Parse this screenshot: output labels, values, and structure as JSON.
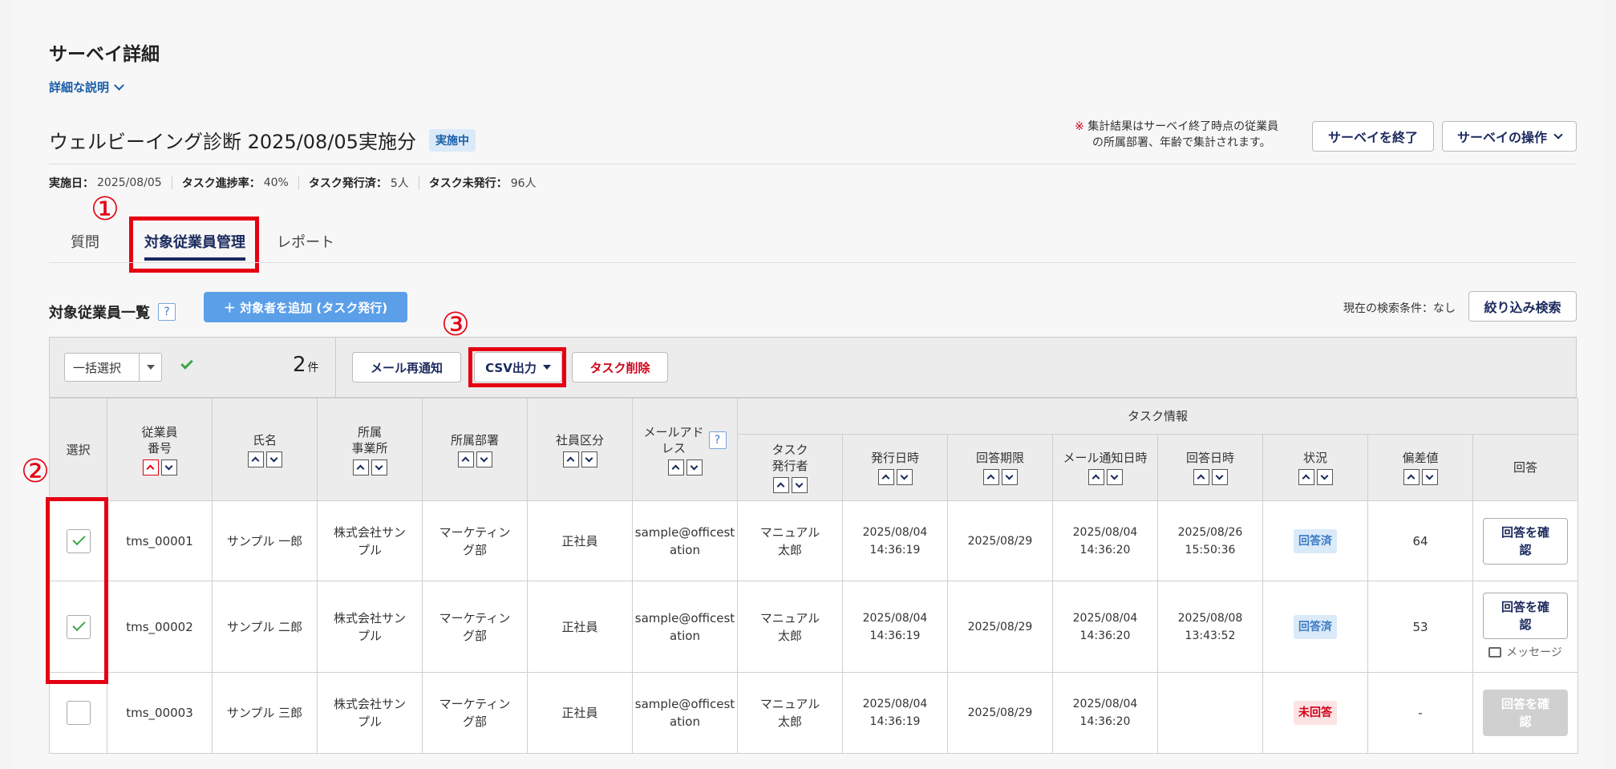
{
  "page": {
    "title": "サーベイ詳細",
    "description_toggle": "詳細な説明"
  },
  "survey": {
    "name": "ウェルビーイング診断 2025/08/05実施分",
    "status_badge": "実施中",
    "note_mark": "※",
    "note_line1": "集計結果はサーベイ終了時点の従業員",
    "note_line2": "の所属部署、年齢で集計されます。",
    "end_button": "サーベイを終了",
    "ops_button": "サーベイの操作"
  },
  "meta": [
    {
      "label": "実施日：",
      "value": "2025/08/05"
    },
    {
      "label": "タスク進捗率：",
      "value": "40%"
    },
    {
      "label": "タスク発行済：",
      "value": "5人"
    },
    {
      "label": "タスク未発行：",
      "value": "96人"
    }
  ],
  "tabs": [
    {
      "label": "質問"
    },
    {
      "label": "対象従業員管理"
    },
    {
      "label": "レポート"
    }
  ],
  "annotations": {
    "n1": "①",
    "n2": "②",
    "n3": "③"
  },
  "list": {
    "title": "対象従業員一覧",
    "help": "?",
    "add_button": "＋ 対象者を追加 (タスク発行)",
    "condition": "現在の検索条件：なし",
    "filter_button": "絞り込み検索"
  },
  "toolbar": {
    "bulk_select": "一括選択",
    "count": "2",
    "count_unit": "件",
    "resend_button": "メール再通知",
    "csv_button": "CSV出力",
    "delete_button": "タスク削除"
  },
  "headers": {
    "select": "選択",
    "emp_no_1": "従業員",
    "emp_no_2": "番号",
    "name": "氏名",
    "office_1": "所属",
    "office_2": "事業所",
    "dept": "所属部署",
    "emp_type": "社員区分",
    "mail_1": "メールアド",
    "mail_2": "レス",
    "task_group": "タスク情報",
    "issuer_1": "タスク",
    "issuer_2": "発行者",
    "issued_at": "発行日時",
    "deadline": "回答期限",
    "mail_notified": "メール通知日時",
    "answered_at": "回答日時",
    "status": "状況",
    "deviation": "偏差値",
    "answer": "回答"
  },
  "rows": [
    {
      "checked": true,
      "emp_no": "tms_00001",
      "name": "サンプル 一郎",
      "office_1": "株式会社サン",
      "office_2": "プル",
      "dept_1": "マーケティン",
      "dept_2": "グ部",
      "emp_type": "正社員",
      "mail_1": "sample@officest",
      "mail_2": "ation",
      "issuer_1": "マニュアル",
      "issuer_2": "太郎",
      "issued_date": "2025/08/04",
      "issued_time": "14:36:19",
      "deadline": "2025/08/29",
      "notified_date": "2025/08/04",
      "notified_time": "14:36:20",
      "answered_date": "2025/08/26",
      "answered_time": "15:50:36",
      "status": "回答済",
      "deviation": "64",
      "answer_1": "回答を確",
      "answer_2": "認"
    },
    {
      "checked": true,
      "emp_no": "tms_00002",
      "name": "サンプル 二郎",
      "office_1": "株式会社サン",
      "office_2": "プル",
      "dept_1": "マーケティン",
      "dept_2": "グ部",
      "emp_type": "正社員",
      "mail_1": "sample@officest",
      "mail_2": "ation",
      "issuer_1": "マニュアル",
      "issuer_2": "太郎",
      "issued_date": "2025/08/04",
      "issued_time": "14:36:19",
      "deadline": "2025/08/29",
      "notified_date": "2025/08/04",
      "notified_time": "14:36:20",
      "answered_date": "2025/08/08",
      "answered_time": "13:43:52",
      "status": "回答済",
      "deviation": "53",
      "answer_1": "回答を確",
      "answer_2": "認",
      "message": "メッセージ"
    },
    {
      "checked": false,
      "emp_no": "tms_00003",
      "name": "サンプル 三郎",
      "office_1": "株式会社サン",
      "office_2": "プル",
      "dept_1": "マーケティン",
      "dept_2": "グ部",
      "emp_type": "正社員",
      "mail_1": "sample@officest",
      "mail_2": "ation",
      "issuer_1": "マニュアル",
      "issuer_2": "太郎",
      "issued_date": "2025/08/04",
      "issued_time": "14:36:19",
      "deadline": "2025/08/29",
      "notified_date": "2025/08/04",
      "notified_time": "14:36:20",
      "answered_date": "",
      "answered_time": "",
      "status": "未回答",
      "deviation": "-",
      "answer_1": "回答を確",
      "answer_2": "認"
    }
  ],
  "colors": {
    "accent": "#1b2a5e",
    "annotation_red": "#e50012",
    "add_button_bg": "#5b9fe8"
  }
}
